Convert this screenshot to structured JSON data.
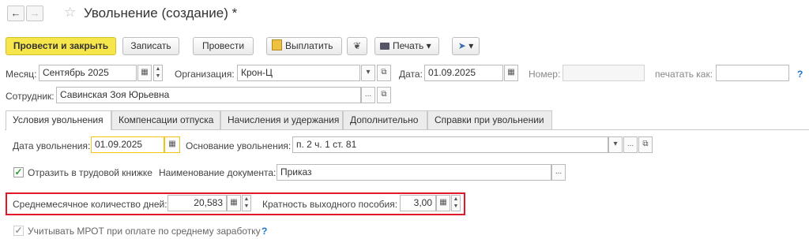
{
  "nav": {
    "back_icon": "arrow-left-icon",
    "forward_icon": "arrow-right-icon",
    "favorite_icon": "star-icon"
  },
  "window": {
    "title": "Увольнение (создание) *"
  },
  "toolbar": {
    "post_close": "Провести и закрыть",
    "save": "Записать",
    "post": "Провести",
    "pay": "Выплатить",
    "print": "Печать",
    "more_arrow": "▾"
  },
  "header": {
    "month_label": "Месяц:",
    "month_value": "Сентябрь 2025",
    "org_label": "Организация:",
    "org_value": "Крон-Ц",
    "date_label": "Дата:",
    "date_value": "01.09.2025",
    "number_label": "Номер:",
    "number_value": "",
    "print_as_label": "печатать как:",
    "print_as_value": "",
    "help": "?",
    "employee_label": "Сотрудник:",
    "employee_value": "Савинская Зоя Юрьевна",
    "ellipsis": "...",
    "open_icon": "⧉",
    "calendar_icon": "▦"
  },
  "tabs": [
    {
      "label": "Условия увольнения"
    },
    {
      "label": "Компенсации отпуска"
    },
    {
      "label": "Начисления и удержания"
    },
    {
      "label": "Дополнительно"
    },
    {
      "label": "Справки при увольнении"
    }
  ],
  "conditions": {
    "dismissal_date_label": "Дата увольнения:",
    "dismissal_date_value": "01.09.2025",
    "basis_label": "Основание увольнения:",
    "basis_value": "п. 2 ч. 1 ст. 81",
    "workbook_label": "Отразить в трудовой книжке",
    "workbook_checked": true,
    "doc_name_label": "Наименование документа:",
    "doc_name_value": "Приказ",
    "avg_days_label": "Среднемесячное количество дней:",
    "avg_days_value": "20,583",
    "multiplicity_label": "Кратность выходного пособия:",
    "multiplicity_value": "3,00",
    "mrot_label": "Учитывать МРОТ при оплате по среднему заработку",
    "mrot_checked": true,
    "help": "?"
  },
  "colors": {
    "primary_button": "#f7e64b",
    "highlight": "#e0192a",
    "focus": "#f1c40f",
    "help": "#1a73d4"
  }
}
